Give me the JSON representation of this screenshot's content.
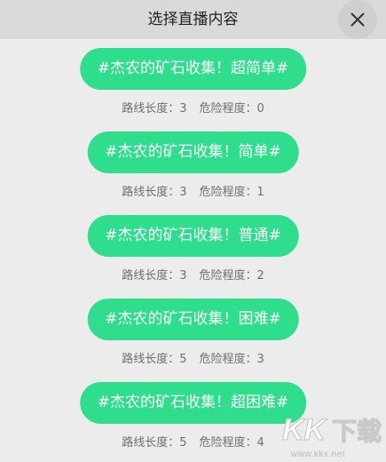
{
  "header": {
    "title": "选择直播内容"
  },
  "icons": {
    "close": "close-icon"
  },
  "colors": {
    "pill": "#2ede8c",
    "header": "#d9d9d9",
    "background": "#ececec"
  },
  "items": [
    {
      "title": "#杰农的矿石收集！超简单#",
      "route_label": "路线长度：",
      "route_value": "3",
      "danger_label": "危险程度：",
      "danger_value": "0"
    },
    {
      "title": "#杰农的矿石收集！简单#",
      "route_label": "路线长度：",
      "route_value": "3",
      "danger_label": "危险程度：",
      "danger_value": "1"
    },
    {
      "title": "#杰农的矿石收集！普通#",
      "route_label": "路线长度：",
      "route_value": "3",
      "danger_label": "危险程度：",
      "danger_value": "2"
    },
    {
      "title": "#杰农的矿石收集！困难#",
      "route_label": "路线长度：",
      "route_value": "5",
      "danger_label": "危险程度：",
      "danger_value": "3"
    },
    {
      "title": "#杰农的矿石收集！超困难#",
      "route_label": "路线长度：",
      "route_value": "5",
      "danger_label": "危险程度：",
      "danger_value": "4"
    }
  ],
  "watermark": {
    "logo": "KK下载",
    "url": "www.kkx.net"
  }
}
